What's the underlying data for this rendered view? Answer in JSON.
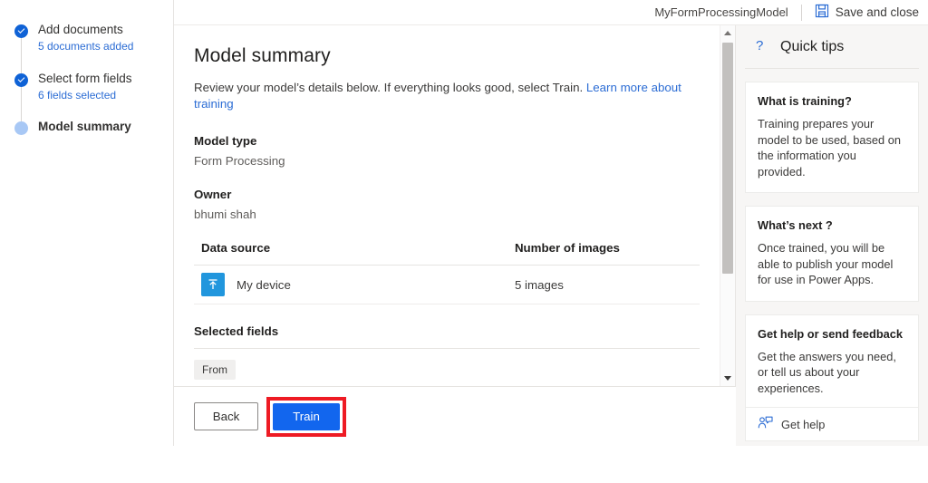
{
  "header": {
    "model_name": "MyFormProcessingModel",
    "save_and_close_label": "Save and close",
    "save_icon": "save-floppy-icon"
  },
  "sidebar": {
    "steps": [
      {
        "title": "Add documents",
        "sub": "5 documents added",
        "state": "done"
      },
      {
        "title": "Select form fields",
        "sub": "6 fields selected",
        "state": "done"
      },
      {
        "title": "Model summary",
        "sub": "",
        "state": "current"
      }
    ]
  },
  "main": {
    "title": "Model summary",
    "description_prefix": "Review your model’s details below. If everything looks good, select Train.",
    "learn_more_link": "Learn more about training",
    "model_type_label": "Model type",
    "model_type_value": "Form Processing",
    "owner_label": "Owner",
    "owner_value": "bhumi shah",
    "table": {
      "columns": [
        "Data source",
        "Number of images"
      ],
      "rows": [
        {
          "icon": "upload-device-icon",
          "source": "My device",
          "images": "5 images"
        }
      ]
    },
    "selected_fields_label": "Selected fields",
    "selected_fields": [
      "From"
    ]
  },
  "footer": {
    "back_label": "Back",
    "train_label": "Train",
    "highlight_color": "#ee1b24"
  },
  "quick_tips": {
    "header_icon": "question-mark-icon",
    "header_title": "Quick tips",
    "cards": [
      {
        "title": "What is training?",
        "body": "Training prepares your model to be used, based on the information you provided."
      },
      {
        "title": "What’s next ?",
        "body": "Once trained, you will be able to publish your model for use in Power Apps."
      },
      {
        "title": "Get help or send feedback",
        "body": "Get the answers you need, or tell us about your experiences.",
        "action_label": "Get help",
        "action_icon": "person-help-icon"
      }
    ]
  },
  "scrollbar": {
    "up_icon": "caret-up-icon",
    "down_icon": "caret-down-icon"
  }
}
